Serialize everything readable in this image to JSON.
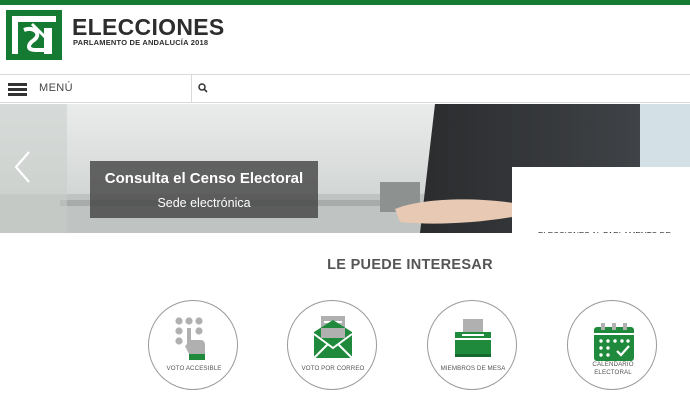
{
  "brand": {
    "title": "ELECCIONES",
    "subtitle": "PARLAMENTO DE ANDALUCÍA 2018"
  },
  "nav": {
    "menu_label": "MENÚ",
    "search_placeholder": ""
  },
  "hero": {
    "title": "Consulta el Censo Electoral",
    "link": "Sede electrónica"
  },
  "section": {
    "title": "LE PUEDE INTERESAR"
  },
  "cards": [
    {
      "label": "VOTO ACCESIBLE",
      "icon": "braille-hand-icon"
    },
    {
      "label": "VOTO POR CORREO",
      "icon": "envelope-icon"
    },
    {
      "label": "MIEMBROS DE MESA",
      "icon": "ballot-box-icon"
    },
    {
      "label": "CALENDARIO ELECTORAL",
      "icon": "calendar-icon"
    }
  ],
  "colors": {
    "brand_green": "#157a32",
    "icon_green": "#1f8a3c",
    "icon_gray": "#b0b0b0"
  }
}
